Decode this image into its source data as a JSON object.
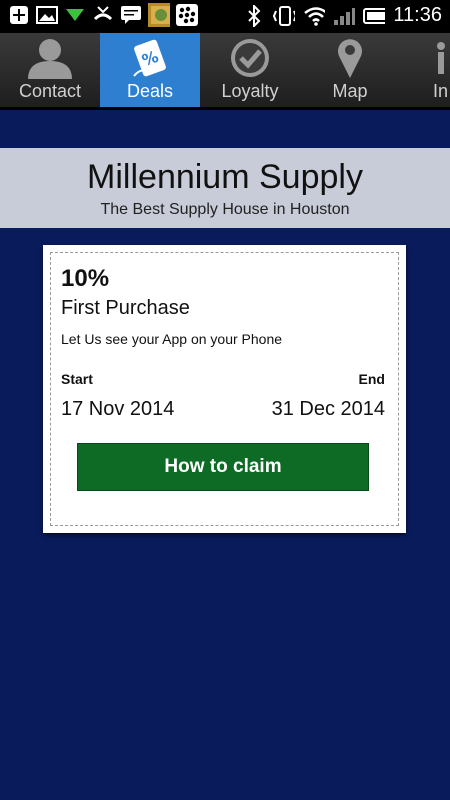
{
  "status_bar": {
    "time": "11:36",
    "icons": [
      "add-icon",
      "image-icon",
      "download-icon",
      "missed-call-icon",
      "message-icon",
      "app-thumbnail-icon",
      "blackberry-icon",
      "bluetooth-icon",
      "vibrate-icon",
      "wifi-icon",
      "signal-icon",
      "battery-icon"
    ]
  },
  "tabs": [
    {
      "label": "Contact",
      "icon": "person-icon",
      "active": false
    },
    {
      "label": "Deals",
      "icon": "deal-tag-icon",
      "active": true
    },
    {
      "label": "Loyalty",
      "icon": "checkmark-icon",
      "active": false
    },
    {
      "label": "Map",
      "icon": "map-pin-icon",
      "active": false
    },
    {
      "label": "In",
      "icon": "info-icon",
      "active": false
    }
  ],
  "header": {
    "title": "Millennium Supply",
    "subtitle": "The Best Supply House in Houston"
  },
  "deal": {
    "percent": "10%",
    "name": "First Purchase",
    "description": "Let Us see your App on your Phone",
    "start_label": "Start",
    "end_label": "End",
    "start_date": "17 Nov 2014",
    "end_date": "31 Dec 2014",
    "claim_label": "How to claim"
  },
  "colors": {
    "background": "#0a1b5c",
    "tab_active": "#2f7fd1",
    "claim_button": "#0d6b26",
    "banner": "#c8cbd8"
  }
}
